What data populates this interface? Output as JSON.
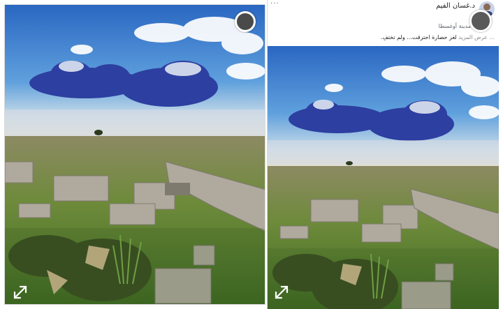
{
  "post": {
    "author": "د.غسان الفيم",
    "line2": "",
    "caption_short": "مدينة أوغسطا",
    "caption": "لغز حضارة احترقت... ولم تختفِ.",
    "see_more": "... عرض المزيد",
    "menu_dots": "···"
  },
  "icons": {
    "avatar": "avatar-icon",
    "expand": "expand-icon",
    "record": "record-button-icon",
    "menu": "more-options-icon"
  },
  "colors": {
    "sky_top": "#1f5fb8",
    "cloud_dark": "#2b3f9e",
    "grass": "#5f8a2f",
    "stone": "#a7a197"
  }
}
